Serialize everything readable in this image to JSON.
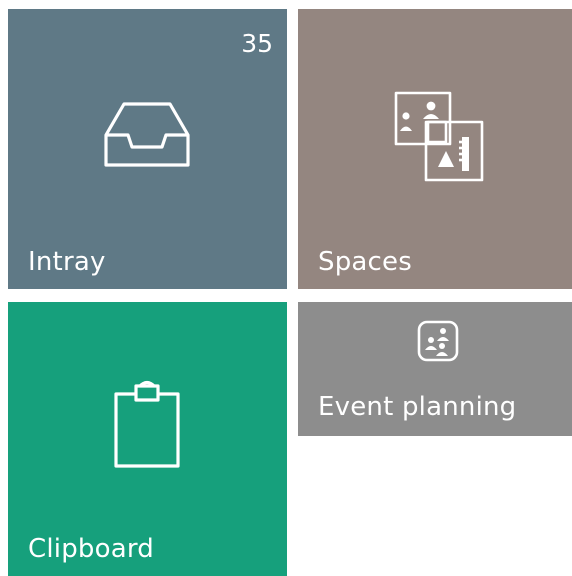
{
  "tiles": [
    {
      "id": "intray",
      "label": "Intray",
      "badge": "35",
      "icon": "inbox-tray-icon",
      "color": "#5f7986"
    },
    {
      "id": "spaces",
      "label": "Spaces",
      "icon": "spaces-icon",
      "color": "#948680"
    },
    {
      "id": "clipboard",
      "label": "Clipboard",
      "icon": "clipboard-icon",
      "color": "#16a07c"
    },
    {
      "id": "event",
      "label": "Event planning",
      "icon": "people-group-icon",
      "color": "#8d8d8d"
    }
  ]
}
